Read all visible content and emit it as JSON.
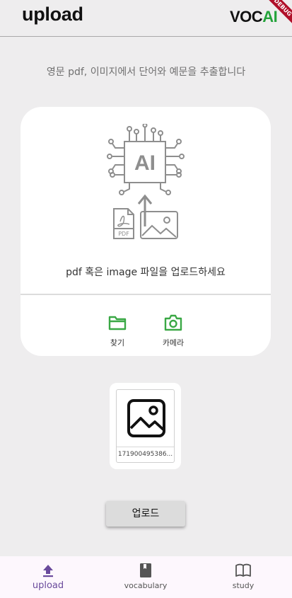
{
  "header": {
    "title": "upload",
    "logo_dark": "VOC",
    "logo_green": "AI",
    "debug_ribbon": "DEBUG"
  },
  "subtitle": "영문 pdf, 이미지에서 단어와 예문을 추출합니다",
  "card": {
    "illustration_chip_label": "AI",
    "illustration_pdf_label": "PDF",
    "prompt": "pdf 혹은 image 파일을 업로드하세요",
    "actions": [
      {
        "label": "찾기",
        "icon": "folder-icon"
      },
      {
        "label": "카메라",
        "icon": "camera-icon"
      }
    ]
  },
  "thumbnail": {
    "filename": "171900495386..."
  },
  "upload_button_label": "업로드",
  "bottom_nav": {
    "items": [
      {
        "label": "upload",
        "icon": "upload-icon",
        "active": true
      },
      {
        "label": "vocabulary",
        "icon": "book-icon",
        "active": false
      },
      {
        "label": "study",
        "icon": "open-book-icon",
        "active": false
      }
    ]
  },
  "colors": {
    "accent_green": "#3aa845",
    "accent_purple": "#6a4a9c",
    "background": "#eeedee"
  }
}
